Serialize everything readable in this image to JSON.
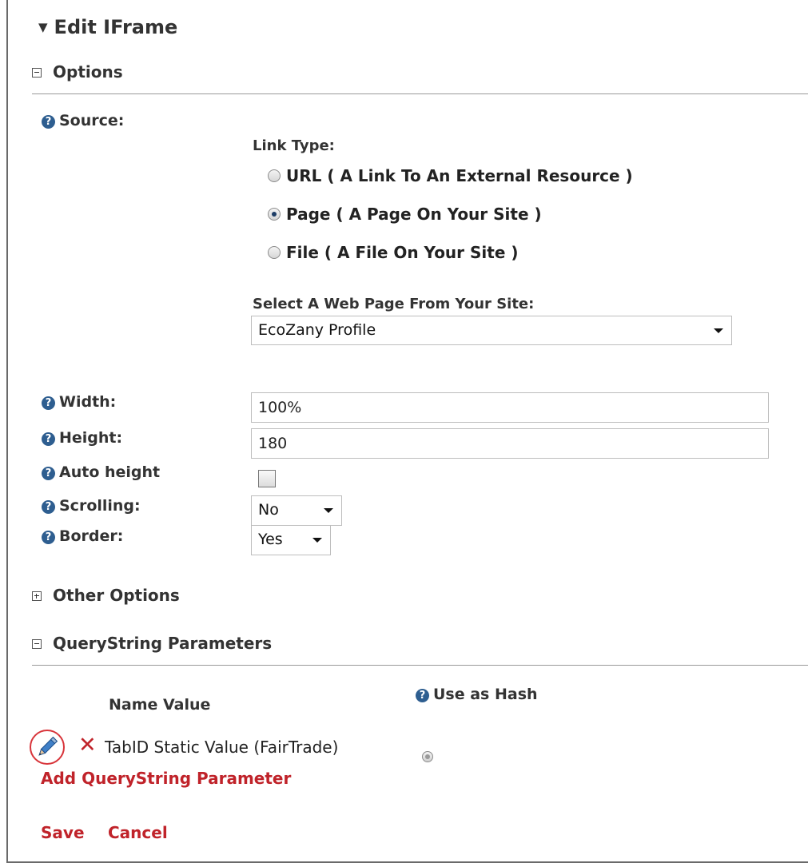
{
  "title": "Edit IFrame",
  "sections": {
    "options": "Options",
    "other_options": "Other Options",
    "querystring": "QueryString Parameters"
  },
  "source": {
    "label": "Source:",
    "link_type_label": "Link Type:",
    "options": [
      {
        "label": "URL ( A Link To An External Resource )",
        "selected": false
      },
      {
        "label": "Page ( A Page On Your Site )",
        "selected": true
      },
      {
        "label": "File ( A File On Your Site )",
        "selected": false
      }
    ],
    "select_page_label": "Select A Web Page From Your Site:",
    "selected_page": "EcoZany Profile"
  },
  "fields": {
    "width_label": "Width:",
    "width_value": "100%",
    "height_label": "Height:",
    "height_value": "180",
    "auto_height_label": "Auto height",
    "auto_height_checked": false,
    "scrolling_label": "Scrolling:",
    "scrolling_value": "No",
    "border_label": "Border:",
    "border_value": "Yes"
  },
  "querystring": {
    "use_as_hash_label": "Use as Hash",
    "header_name_value": "Name Value",
    "rows": [
      {
        "text": "TabID Static Value (FairTrade)"
      }
    ],
    "add_link": "Add QueryString Parameter"
  },
  "actions": {
    "save": "Save",
    "cancel": "Cancel"
  },
  "colors": {
    "link": "#c0232a",
    "help_icon": "#2e5e90",
    "highlight_circle": "#d8343a"
  }
}
